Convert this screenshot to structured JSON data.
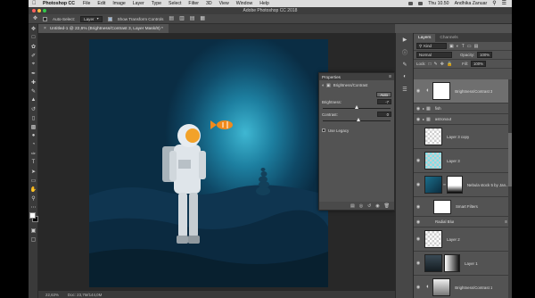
{
  "menubar": {
    "app_name": "Photoshop CC",
    "items": [
      "File",
      "Edit",
      "Image",
      "Layer",
      "Type",
      "Select",
      "Filter",
      "3D",
      "View",
      "Window",
      "Help"
    ],
    "clock": "Thu 10.50",
    "user": "Andhika Zanuar"
  },
  "window": {
    "title": "Adobe Photoshop CC 2018"
  },
  "options": {
    "auto_select_label": "Auto-Select:",
    "auto_select_value": "Layer",
    "transform_label": "Show Transform Controls"
  },
  "document": {
    "tab_title": "Untitled-1 @ 22,6% (Brightness/Contrast 3, Layer Mask/8) *"
  },
  "status": {
    "zoom": "22,63%",
    "doc_info": "Doc: 23,7M/144,0M"
  },
  "properties": {
    "title": "Properties",
    "adjustment_name": "Brightness/Contrast",
    "auto_label": "Auto",
    "brightness_label": "Brightness:",
    "brightness_value": "-7",
    "brightness_pos": 0.48,
    "contrast_label": "Contrast:",
    "contrast_value": "0",
    "contrast_pos": 0.5,
    "legacy_label": "Use Legacy"
  },
  "layers_panel": {
    "tabs": [
      "Layers",
      "Channels"
    ],
    "filter_label": "Kind",
    "blend_mode": "Normal",
    "opacity_label": "Opacity:",
    "opacity_value": "100%",
    "lock_label": "Lock:",
    "fill_label": "Fill:",
    "fill_value": "100%",
    "layers": [
      {
        "name": "Brightness/Contrast 3",
        "type": "adjustment",
        "selected": true
      },
      {
        "name": "fish",
        "type": "group"
      },
      {
        "name": "astronout",
        "type": "group"
      },
      {
        "name": "Layer 3 copy",
        "type": "pixel-check"
      },
      {
        "name": "Layer 3",
        "type": "pixel-cyan"
      },
      {
        "name": "Nebula stock 5 by Jan...",
        "type": "smart"
      },
      {
        "name": "Smart Filters",
        "type": "smart-filters"
      },
      {
        "name": "Radial Blur",
        "type": "filter"
      },
      {
        "name": "Layer 2",
        "type": "pixel-check"
      },
      {
        "name": "Layer 1",
        "type": "pixel-rock"
      },
      {
        "name": "Brightness/Contrast 1",
        "type": "adjustment-rock"
      }
    ]
  }
}
